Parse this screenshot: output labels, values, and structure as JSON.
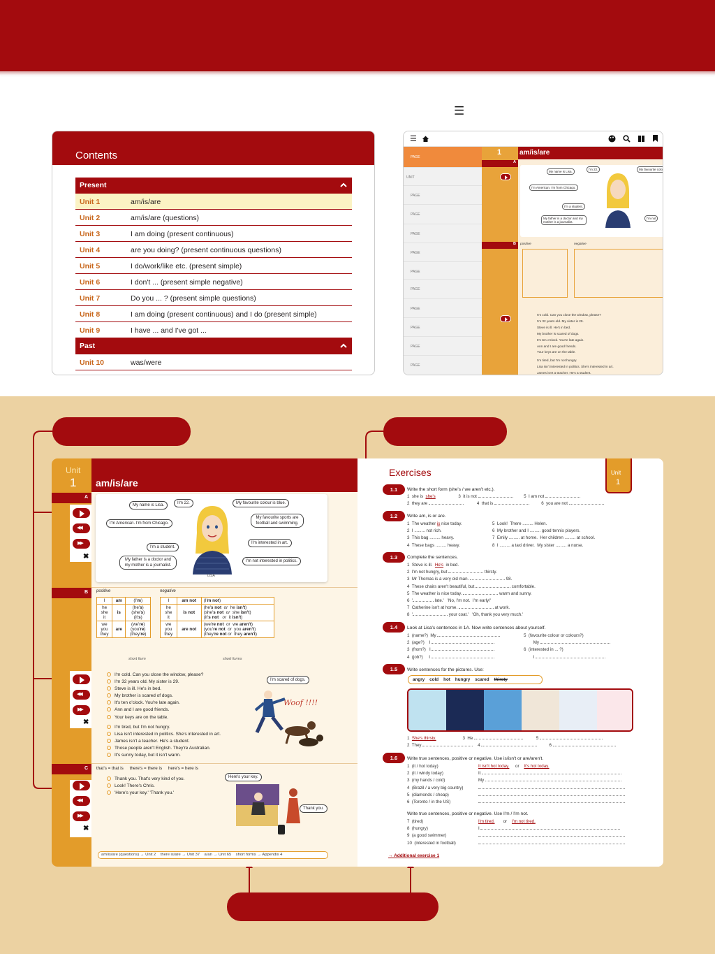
{
  "header": {
    "menu_icon": "hamburger-icon",
    "brand_color": "#a30b0e"
  },
  "contents": {
    "title": "Contents",
    "sections": [
      {
        "label": "Present",
        "units": [
          {
            "unit": "Unit 1",
            "title": "am/is/are",
            "highlighted": true
          },
          {
            "unit": "Unit 2",
            "title": "am/is/are  (questions)"
          },
          {
            "unit": "Unit 3",
            "title": "I am doing  (present continuous)"
          },
          {
            "unit": "Unit 4",
            "title": "are you doing?  (present continuous questions)"
          },
          {
            "unit": "Unit 5",
            "title": "I do/work/like etc.  (present simple)"
          },
          {
            "unit": "Unit 6",
            "title": "I don't ...  (present simple negative)"
          },
          {
            "unit": "Unit 7",
            "title": "Do you ... ?  (present simple questions)"
          },
          {
            "unit": "Unit 8",
            "title": "I am doing (present continuous) and I do (present simple)"
          },
          {
            "unit": "Unit 9",
            "title": "I have ...  and  I've got ..."
          }
        ]
      },
      {
        "label": "Past",
        "units": [
          {
            "unit": "Unit 10",
            "title": "was/were"
          }
        ]
      }
    ]
  },
  "tablet": {
    "unit_number": "1",
    "title": "am/is/are",
    "side_items": [
      "PAGE",
      "UNIT",
      "PAGE",
      "PAGE",
      "PAGE",
      "PAGE",
      "PAGE",
      "PAGE",
      "PAGE",
      "PAGE",
      "PAGE",
      "PAGE"
    ],
    "section_a": "A",
    "section_b": "B",
    "bubbles": [
      "My name is Lisa.",
      "I'm 22.",
      "My favourite colour",
      "I'm American. I'm from Chicago.",
      "I'm a student.",
      "My father is a doctor and my mother is a journalist.",
      "I'm not"
    ],
    "positive_label": "positive",
    "negative_label": "negative",
    "lines": [
      "I'm cold. Can you close the window, please?",
      "I'm 32 years old. My sister is 29.",
      "Steve is ill. He's in bed.",
      "My brother is scared of dogs.",
      "It's ten o'clock. You're late again.",
      "Ann and I are good friends.",
      "Your keys are on the table.",
      "I'm tired, but I'm not hungry.",
      "Lisa isn't interested in politics. She's interested in art.",
      "James isn't a teacher. He's a student."
    ]
  },
  "unit_page": {
    "unit_label": "Unit",
    "unit_number": "1",
    "title": "am/is/are",
    "bubbles": {
      "name": "My name is Lisa.",
      "age": "I'm 22.",
      "colour": "My favourite colour is blue.",
      "american": "I'm American. I'm from Chicago.",
      "sports": "My favourite sports are football and swimming.",
      "student": "I'm a student.",
      "art": "I'm interested in art.",
      "father": "My father is a doctor and my mother is a journalist.",
      "politics": "I'm not interested in politics."
    },
    "caption": "LISA",
    "pos_label": "positive",
    "neg_label": "negative",
    "short_form": "short form",
    "short_forms": "short forms",
    "lines_b1": [
      "I'm cold.  Can you close the window, please?",
      "I'm 32 years old.  My sister is 29.",
      "Steve is ill.  He's in bed.",
      "My brother is scared of dogs.",
      "It's ten o'clock.  You're late again.",
      "Ann and I are good friends.",
      "Your keys are on the table."
    ],
    "lines_b2": [
      "I'm tired, but I'm not hungry.",
      "Lisa isn't interested in politics.  She's interested in art.",
      "James isn't a teacher.  He's a student.",
      "Those people aren't English.  They're Australian.",
      "It's sunny today, but it isn't warm."
    ],
    "dogs_bubble": "I'm scared of dogs.",
    "woof": "Woof !!!!",
    "c_header": "that's = that is     there's = there is     here's = here is",
    "lines_c": [
      "Thank you.  That's very kind of you.",
      "Look!  There's Chris.",
      "'Here's your key.'    'Thank you.'"
    ],
    "key_bubble": "Here's your key.",
    "thanks_bubble": "Thank you.",
    "footer": "am/is/are (questions) → Unit 2    there is/are → Unit 37    a/an → Unit 65    short forms → Appendix 4"
  },
  "exercises_page": {
    "title": "Exercises",
    "unit_label": "Unit",
    "unit_number": "1",
    "items": [
      {
        "id": "1.1",
        "q": "Write the short form (she's / we aren't etc.)."
      },
      {
        "id": "1.2",
        "q": "Write am, is or are."
      },
      {
        "id": "1.3",
        "q": "Complete the sentences."
      },
      {
        "id": "1.4",
        "q": "Look at Lisa's sentences in 1A.  Now write sentences about yourself."
      },
      {
        "id": "1.5",
        "q": "Write sentences for the pictures.  Use:"
      },
      {
        "id": "1.6",
        "q": "Write true sentences, positive or negative.  Use is/isn't or are/aren't."
      }
    ],
    "words_15": [
      "angry",
      "cold",
      "hot",
      "hungry",
      "scared",
      "thirsty"
    ],
    "q16b": "Write true sentences, positive or negative.  Use I'm / I'm not.",
    "additional": "→ Additional exercise 1"
  }
}
